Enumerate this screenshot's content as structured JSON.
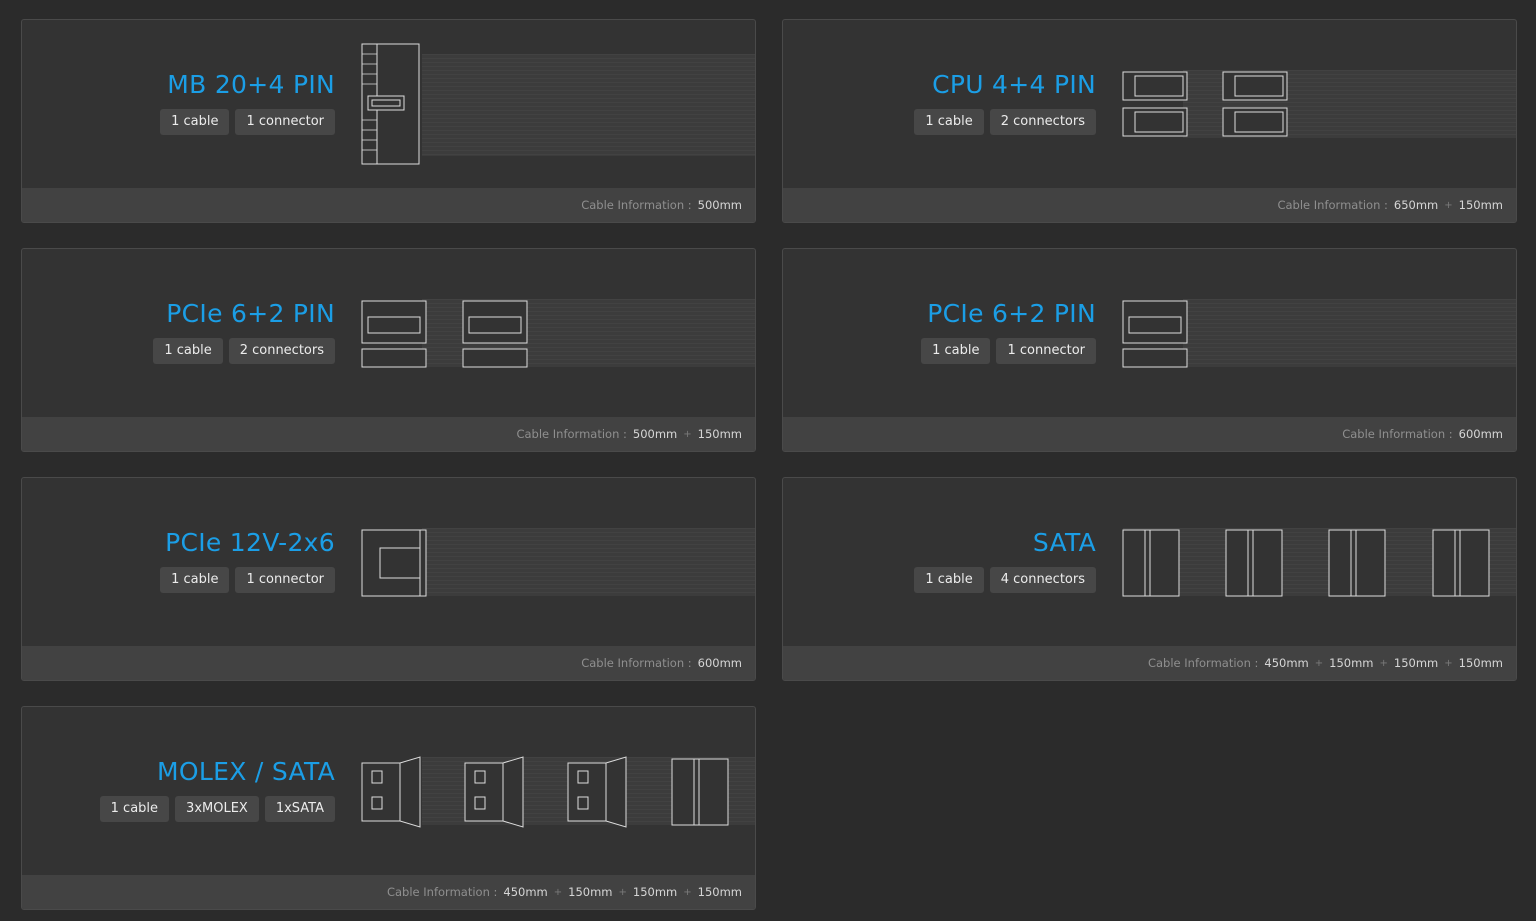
{
  "accent_color": "#1b9ee6",
  "info_label": "Cable Information :",
  "cards": [
    {
      "title": "MB 20+4 PIN",
      "badges": [
        "1 cable",
        "1 connector"
      ],
      "lengths": [
        "500mm"
      ]
    },
    {
      "title": "CPU 4+4 PIN",
      "badges": [
        "1 cable",
        "2 connectors"
      ],
      "lengths": [
        "650mm",
        "150mm"
      ]
    },
    {
      "title": "PCIe 6+2 PIN",
      "badges": [
        "1 cable",
        "2 connectors"
      ],
      "lengths": [
        "500mm",
        "150mm"
      ]
    },
    {
      "title": "PCIe 6+2 PIN",
      "badges": [
        "1 cable",
        "1 connector"
      ],
      "lengths": [
        "600mm"
      ]
    },
    {
      "title": "PCIe 12V-2x6",
      "badges": [
        "1 cable",
        "1 connector"
      ],
      "lengths": [
        "600mm"
      ]
    },
    {
      "title": "SATA",
      "badges": [
        "1 cable",
        "4 connectors"
      ],
      "lengths": [
        "450mm",
        "150mm",
        "150mm",
        "150mm"
      ]
    },
    {
      "title": "MOLEX / SATA",
      "badges": [
        "1 cable",
        "3xMOLEX",
        "1xSATA"
      ],
      "lengths": [
        "450mm",
        "150mm",
        "150mm",
        "150mm"
      ]
    }
  ]
}
